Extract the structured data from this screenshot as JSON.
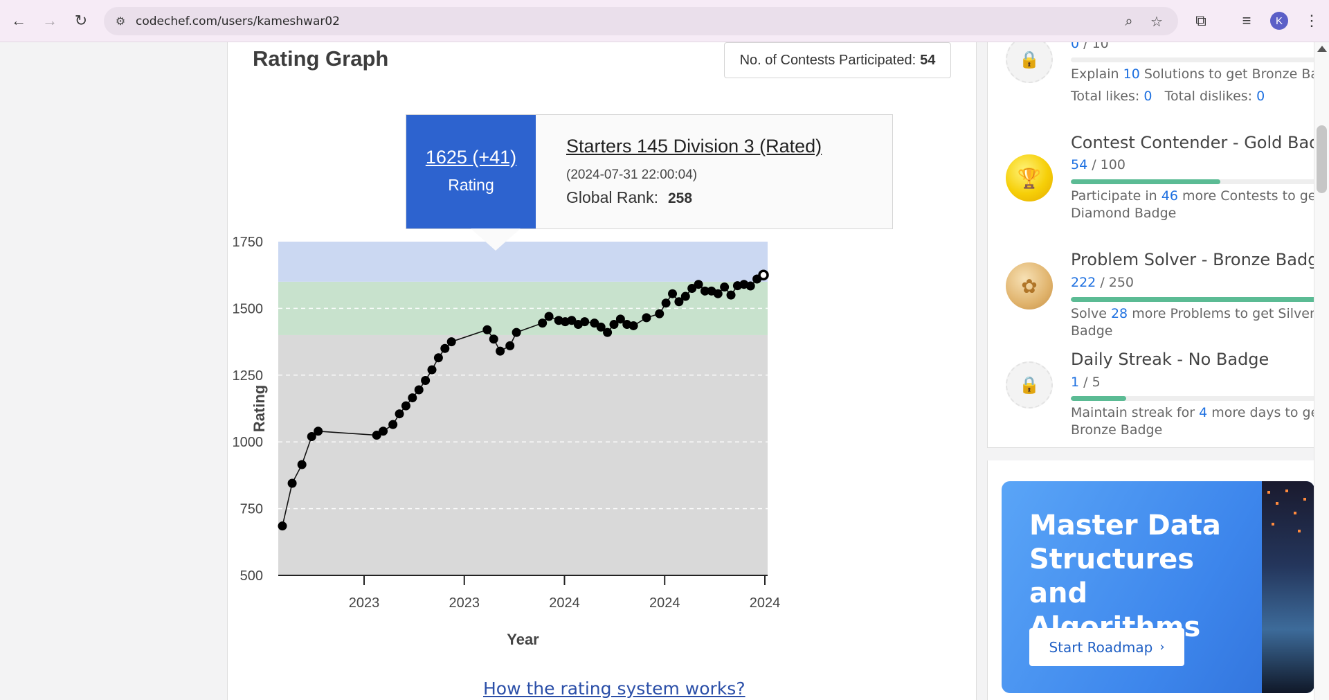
{
  "browser": {
    "url": "codechef.com/users/kameshwar02",
    "avatar_letter": "K"
  },
  "rating_graph": {
    "title": "Rating Graph",
    "contests_label": "No. of Contests Participated:",
    "contests_count": "54",
    "tooltip": {
      "rating": "1625 (+41)",
      "rating_label": "Rating",
      "contest_name": "Starters 145 Division 3 (Rated)",
      "datetime": "(2024-07-31 22:00:04)",
      "rank_label": "Global Rank:",
      "rank_value": "258"
    },
    "link": "How the rating system works?"
  },
  "chart_data": {
    "type": "line",
    "xlabel": "Year",
    "ylabel": "Rating",
    "ylim": [
      500,
      1750
    ],
    "yticks": [
      500,
      750,
      1000,
      1250,
      1500,
      1750
    ],
    "xtick_labels": [
      "2023",
      "2023",
      "2024",
      "2024",
      "2024"
    ],
    "bands": [
      {
        "from": 500,
        "to": 1400,
        "color": "#d9d9d9"
      },
      {
        "from": 1400,
        "to": 1600,
        "color": "#c8e2cd"
      },
      {
        "from": 1600,
        "to": 1750,
        "color": "#cbd8f2"
      }
    ],
    "grid": "horizontal dashed",
    "series": [
      {
        "x": [
          0,
          3,
          6,
          9,
          11,
          29,
          31,
          34,
          36,
          38,
          40,
          42,
          44,
          46,
          48,
          50,
          52,
          63,
          65,
          67,
          70,
          72,
          80,
          82,
          85,
          87,
          89,
          91,
          93,
          96,
          98,
          100,
          102,
          104,
          106,
          108,
          112,
          116,
          118,
          120,
          122,
          124,
          126,
          128,
          130,
          132,
          134,
          136,
          138,
          140,
          142,
          144,
          146,
          148
        ],
        "values": [
          685,
          845,
          915,
          1020,
          1040,
          1025,
          1040,
          1065,
          1105,
          1135,
          1165,
          1195,
          1230,
          1270,
          1315,
          1350,
          1375,
          1420,
          1385,
          1340,
          1360,
          1410,
          1445,
          1470,
          1455,
          1450,
          1455,
          1440,
          1450,
          1445,
          1430,
          1410,
          1440,
          1460,
          1440,
          1435,
          1465,
          1480,
          1520,
          1555,
          1525,
          1545,
          1575,
          1590,
          1565,
          1565,
          1555,
          1580,
          1550,
          1585,
          1590,
          1584,
          1610,
          1625
        ]
      }
    ]
  },
  "badges": [
    {
      "progress_value": "0",
      "progress_total": "/ 10",
      "fill": 0,
      "desc_pre": "Explain",
      "desc_num": "10",
      "desc_post": "Solutions to get Bronze Badge",
      "likes_label": "Total likes:",
      "likes": "0",
      "dislikes_label": "Total dislikes:",
      "dislikes": "0"
    },
    {
      "title": "Contest Contender - Gold Badge",
      "progress_value": "54",
      "progress_total": "/ 100",
      "fill": 0.54,
      "desc_pre": "Participate in",
      "desc_num": "46",
      "desc_post": "more Contests to get Diamond Badge"
    },
    {
      "title": "Problem Solver - Bronze Badge",
      "progress_value": "222",
      "progress_total": "/ 250",
      "fill": 0.888,
      "desc_pre": "Solve",
      "desc_num": "28",
      "desc_post": "more Problems to get Silver Badge"
    },
    {
      "title": "Daily Streak - No Badge",
      "progress_value": "1",
      "progress_total": "/ 5",
      "fill": 0.2,
      "desc_pre": "Maintain streak for",
      "desc_num": "4",
      "desc_post": "more days to get Bronze Badge"
    }
  ],
  "ad": {
    "title": "Master Data Structures and Algorithms",
    "button": "Start Roadmap",
    "button_chevron": "›"
  },
  "icons": {
    "back": "back-arrow-icon",
    "forward": "forward-arrow-icon",
    "reload": "reload-icon",
    "site_settings": "tune-icon",
    "zoom": "zoom-icon",
    "bookmark": "star-icon",
    "extensions": "puzzle-icon",
    "media": "media-queue-icon",
    "menu": "kebab-menu-icon"
  }
}
